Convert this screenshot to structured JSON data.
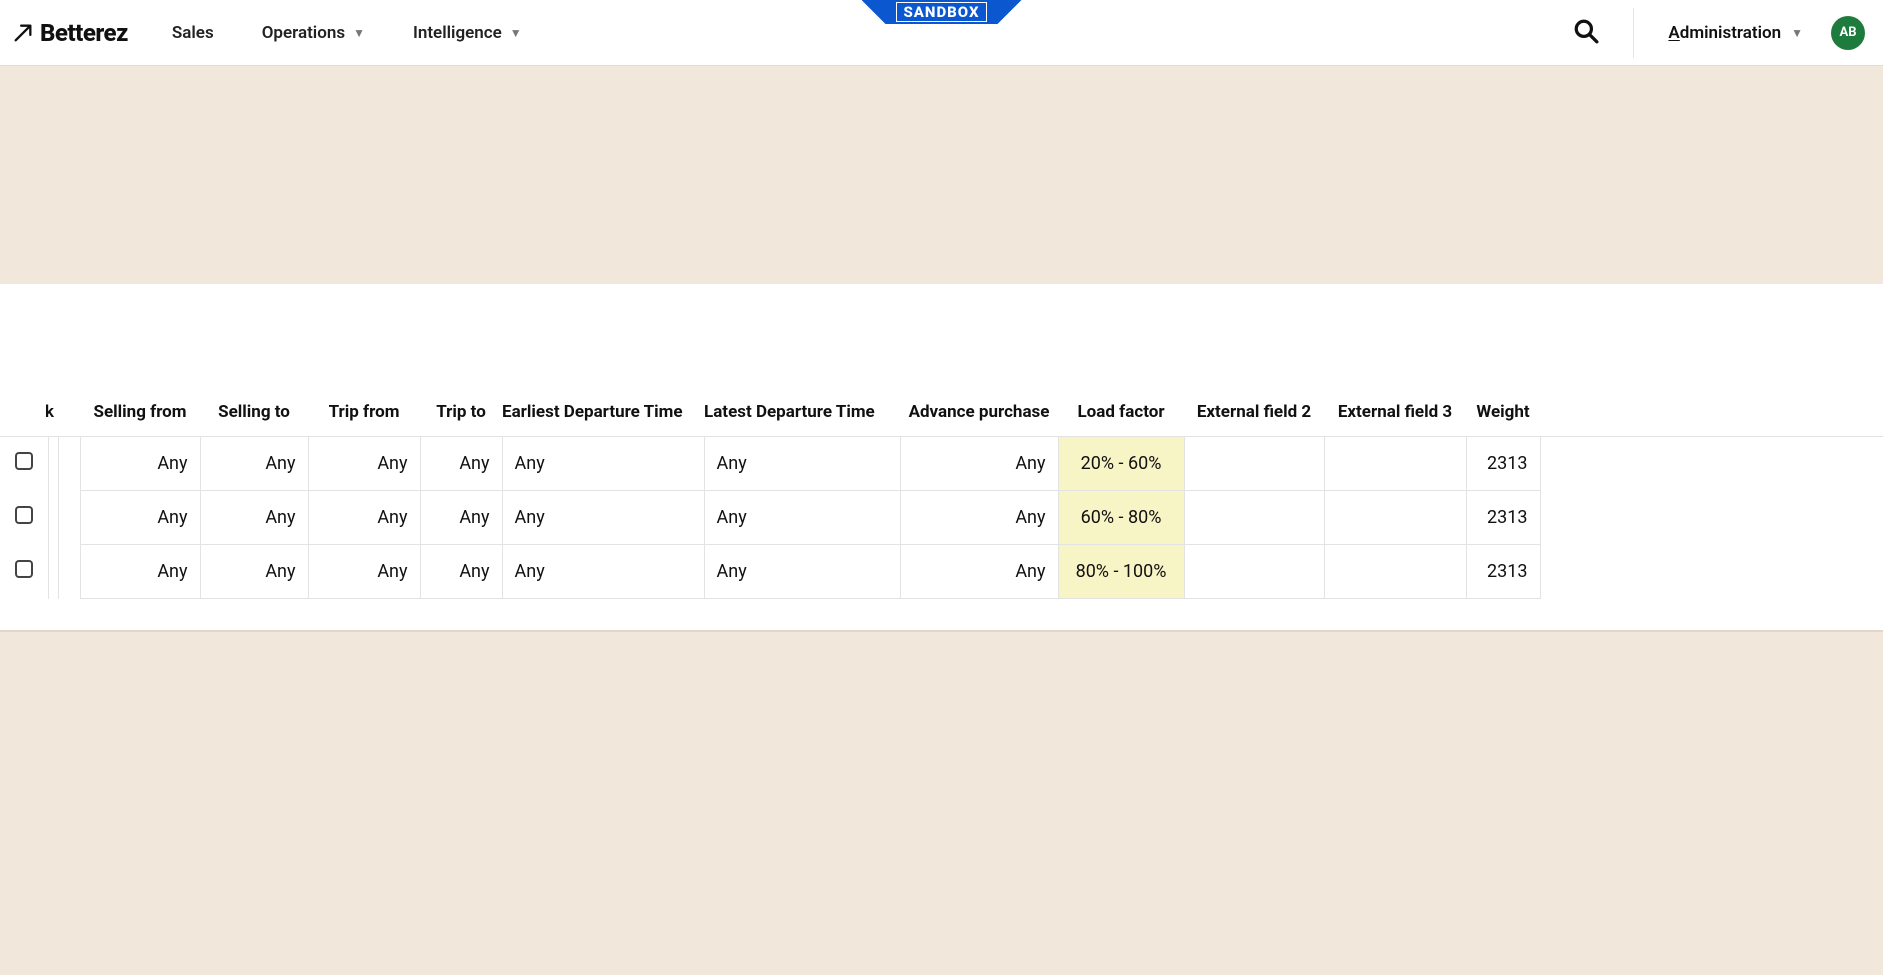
{
  "header": {
    "brand_name": "Betterez",
    "sandbox_label": "SANDBOX",
    "avatar_initials": "AB",
    "nav": {
      "sales": "Sales",
      "operations": "Operations",
      "intelligence": "Intelligence",
      "administration_prefix": "A",
      "administration_rest": "dministration"
    }
  },
  "table": {
    "partial_header": "k",
    "columns": {
      "selling_from": "Selling from",
      "selling_to": "Selling to",
      "trip_from": "Trip from",
      "trip_to": "Trip to",
      "earliest_departure": "Earliest Departure Time",
      "latest_departure": "Latest Departure Time",
      "advance_purchase": "Advance purchase",
      "load_factor": "Load factor",
      "external_field_2": "External field 2",
      "external_field_3": "External field 3",
      "weight": "Weight"
    },
    "rows": [
      {
        "selling_from": "Any",
        "selling_to": "Any",
        "trip_from": "Any",
        "trip_to": "Any",
        "earliest_departure": "Any",
        "latest_departure": "Any",
        "advance_purchase": "Any",
        "load_factor": "20% - 60%",
        "external_field_2": "",
        "external_field_3": "",
        "weight": "2313"
      },
      {
        "selling_from": "Any",
        "selling_to": "Any",
        "trip_from": "Any",
        "trip_to": "Any",
        "earliest_departure": "Any",
        "latest_departure": "Any",
        "advance_purchase": "Any",
        "load_factor": "60% - 80%",
        "external_field_2": "",
        "external_field_3": "",
        "weight": "2313"
      },
      {
        "selling_from": "Any",
        "selling_to": "Any",
        "trip_from": "Any",
        "trip_to": "Any",
        "earliest_departure": "Any",
        "latest_departure": "Any",
        "advance_purchase": "Any",
        "load_factor": "80% - 100%",
        "external_field_2": "",
        "external_field_3": "",
        "weight": "2313"
      }
    ]
  }
}
